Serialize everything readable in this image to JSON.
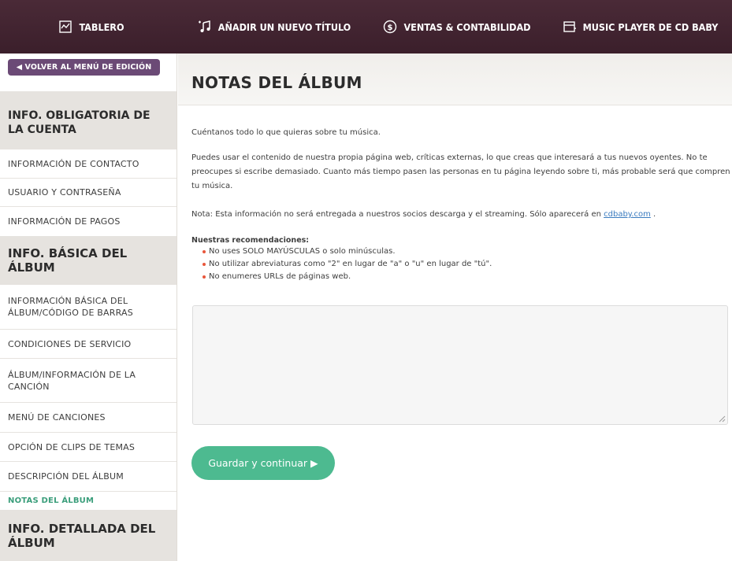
{
  "topnav": {
    "items": [
      {
        "label": "TABLERO",
        "icon": "dashboard-icon"
      },
      {
        "label": "AÑADIR UN NUEVO TÍTULO",
        "icon": "music-note-icon"
      },
      {
        "label": "VENTAS & CONTABILIDAD",
        "icon": "dollar-circle-icon"
      },
      {
        "label": "MUSIC PLAYER DE CD BABY",
        "icon": "player-icon"
      }
    ]
  },
  "sidebar": {
    "back_label": "◀ VOLVER AL MENÚ DE EDICIÓN",
    "sections": [
      {
        "title": "INFO. OBLIGATORIA DE LA CUENTA"
      },
      {
        "title": "INFO. BÁSICA DEL ÁLBUM"
      },
      {
        "title": "INFO. DETALLADA DEL ÁLBUM"
      }
    ],
    "items": [
      "INFORMACIÓN DE CONTACTO",
      "USUARIO Y CONTRASEÑA",
      "INFORMACIÓN DE PAGOS",
      "INFORMACIÓN BÁSICA DEL ÁLBUM/CÓDIGO DE BARRAS",
      "CONDICIONES DE SERVICIO",
      "ÁLBUM/INFORMACIÓN DE LA CANCIÓN",
      "MENÚ DE CANCIONES",
      "OPCIÓN DE CLIPS DE TEMAS",
      "DESCRIPCIÓN DEL ÁLBUM",
      "NOTAS DEL ÁLBUM"
    ],
    "active_item": "NOTAS DEL ÁLBUM"
  },
  "main": {
    "title": "NOTAS DEL ÁLBUM",
    "intro": "Cuéntanos todo lo que quieras sobre tu música.",
    "para": "Puedes usar el contenido de nuestra propia página web, críticas externas, lo que creas que interesará a tus nuevos oyentes. No te preocupes si escribe demasiado. Cuanto más tiempo pasen las personas en tu página leyendo sobre ti, más probable será que compren tu música.",
    "note_prefix": "Nota: Esta información no será entregada a nuestros socios descarga y el streaming. Sólo aparecerá en ",
    "note_link": "cdbaby.com",
    "note_suffix": " .",
    "recommendations_title": "Nuestras recomendaciones:",
    "recommendations": [
      "No uses SOLO MAYÚSCULAS o solo minúsculas.",
      "No utilizar abreviaturas como \"2\" en lugar de \"a\" o \"u\" en lugar de \"tú\".",
      "No enumeres URLs de páginas web."
    ],
    "notes_value": "",
    "save_label": "Guardar y continuar ▶"
  },
  "colors": {
    "nav_bg": "#3b1f2b",
    "back_btn": "#6b4a76",
    "accent_green": "#4dba90",
    "bullet": "#e8563b",
    "link": "#3a7bbf"
  }
}
